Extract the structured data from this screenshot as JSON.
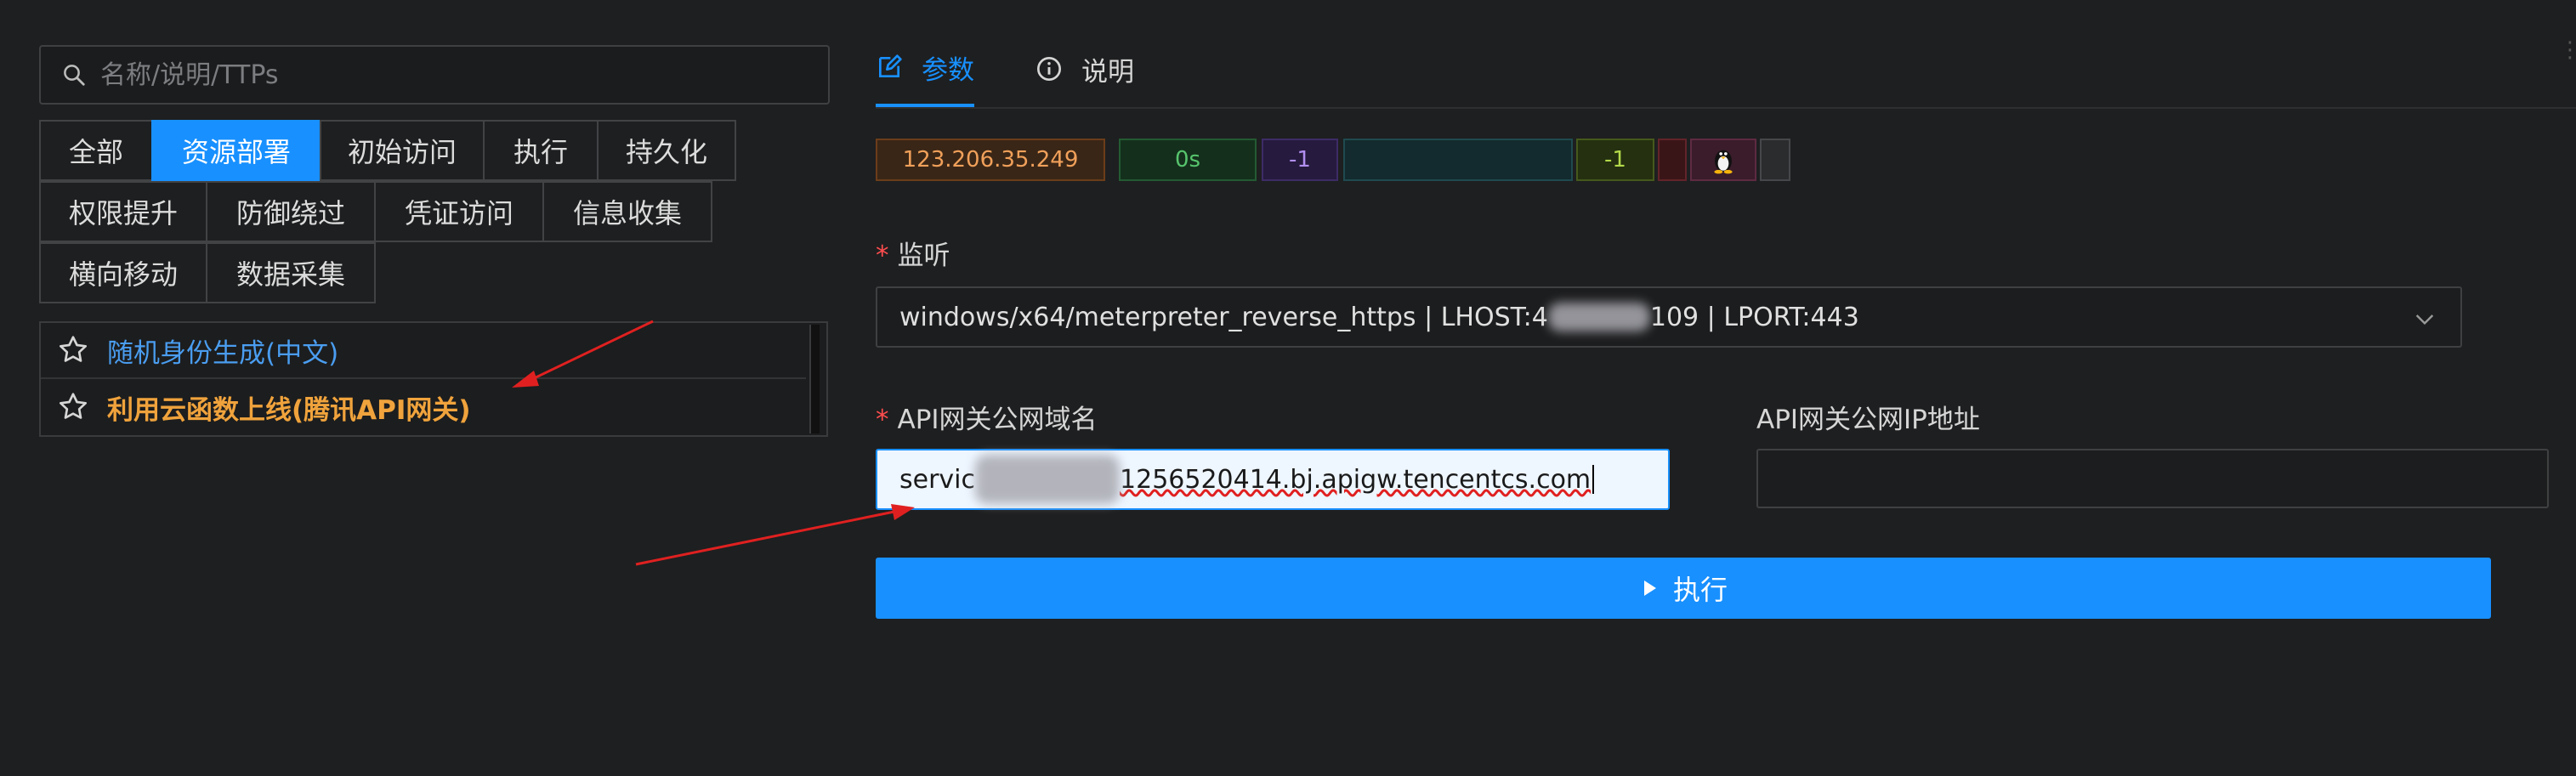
{
  "search": {
    "placeholder": "名称/说明/TTPs"
  },
  "tags": {
    "row1": [
      "全部",
      "资源部署",
      "初始访问",
      "执行",
      "持久化"
    ],
    "row2": [
      "权限提升",
      "防御绕过",
      "凭证访问",
      "信息收集"
    ],
    "row3": [
      "横向移动",
      "数据采集"
    ],
    "active": "资源部署"
  },
  "list": {
    "items": [
      {
        "label": "随机身份生成(中文)",
        "icon": "star-outline-icon"
      },
      {
        "label": "利用云函数上线(腾讯API网关)",
        "icon": "star-outline-icon"
      }
    ]
  },
  "tabs": [
    {
      "label": "参数",
      "icon": "edit-icon",
      "active": true
    },
    {
      "label": "说明",
      "icon": "info-circle-icon",
      "active": false
    }
  ],
  "status": {
    "ip": "123.206.35.249",
    "time": "0s",
    "v1": "-1",
    "empty": "",
    "v2": "-1",
    "os_icon": "linux-tux-icon"
  },
  "form": {
    "listener_label": "监听",
    "listener_value_prefix": "windows/x64/meterpreter_reverse_https | LHOST:4",
    "listener_value_suffix": "109 | LPORT:443",
    "domain_label": "API网关公网域名",
    "domain_value_prefix": "servic",
    "domain_value_suffix": "1256520414.bj.apigw.tencentcs.com",
    "ip_label": "API网关公网IP地址",
    "ip_value": "",
    "run_label": "执行"
  },
  "colors": {
    "accent": "#1890ff",
    "required": "#ff4d4f",
    "highlight": "#f0a33c",
    "link": "#4a9df0",
    "arrow": "#e02020"
  }
}
